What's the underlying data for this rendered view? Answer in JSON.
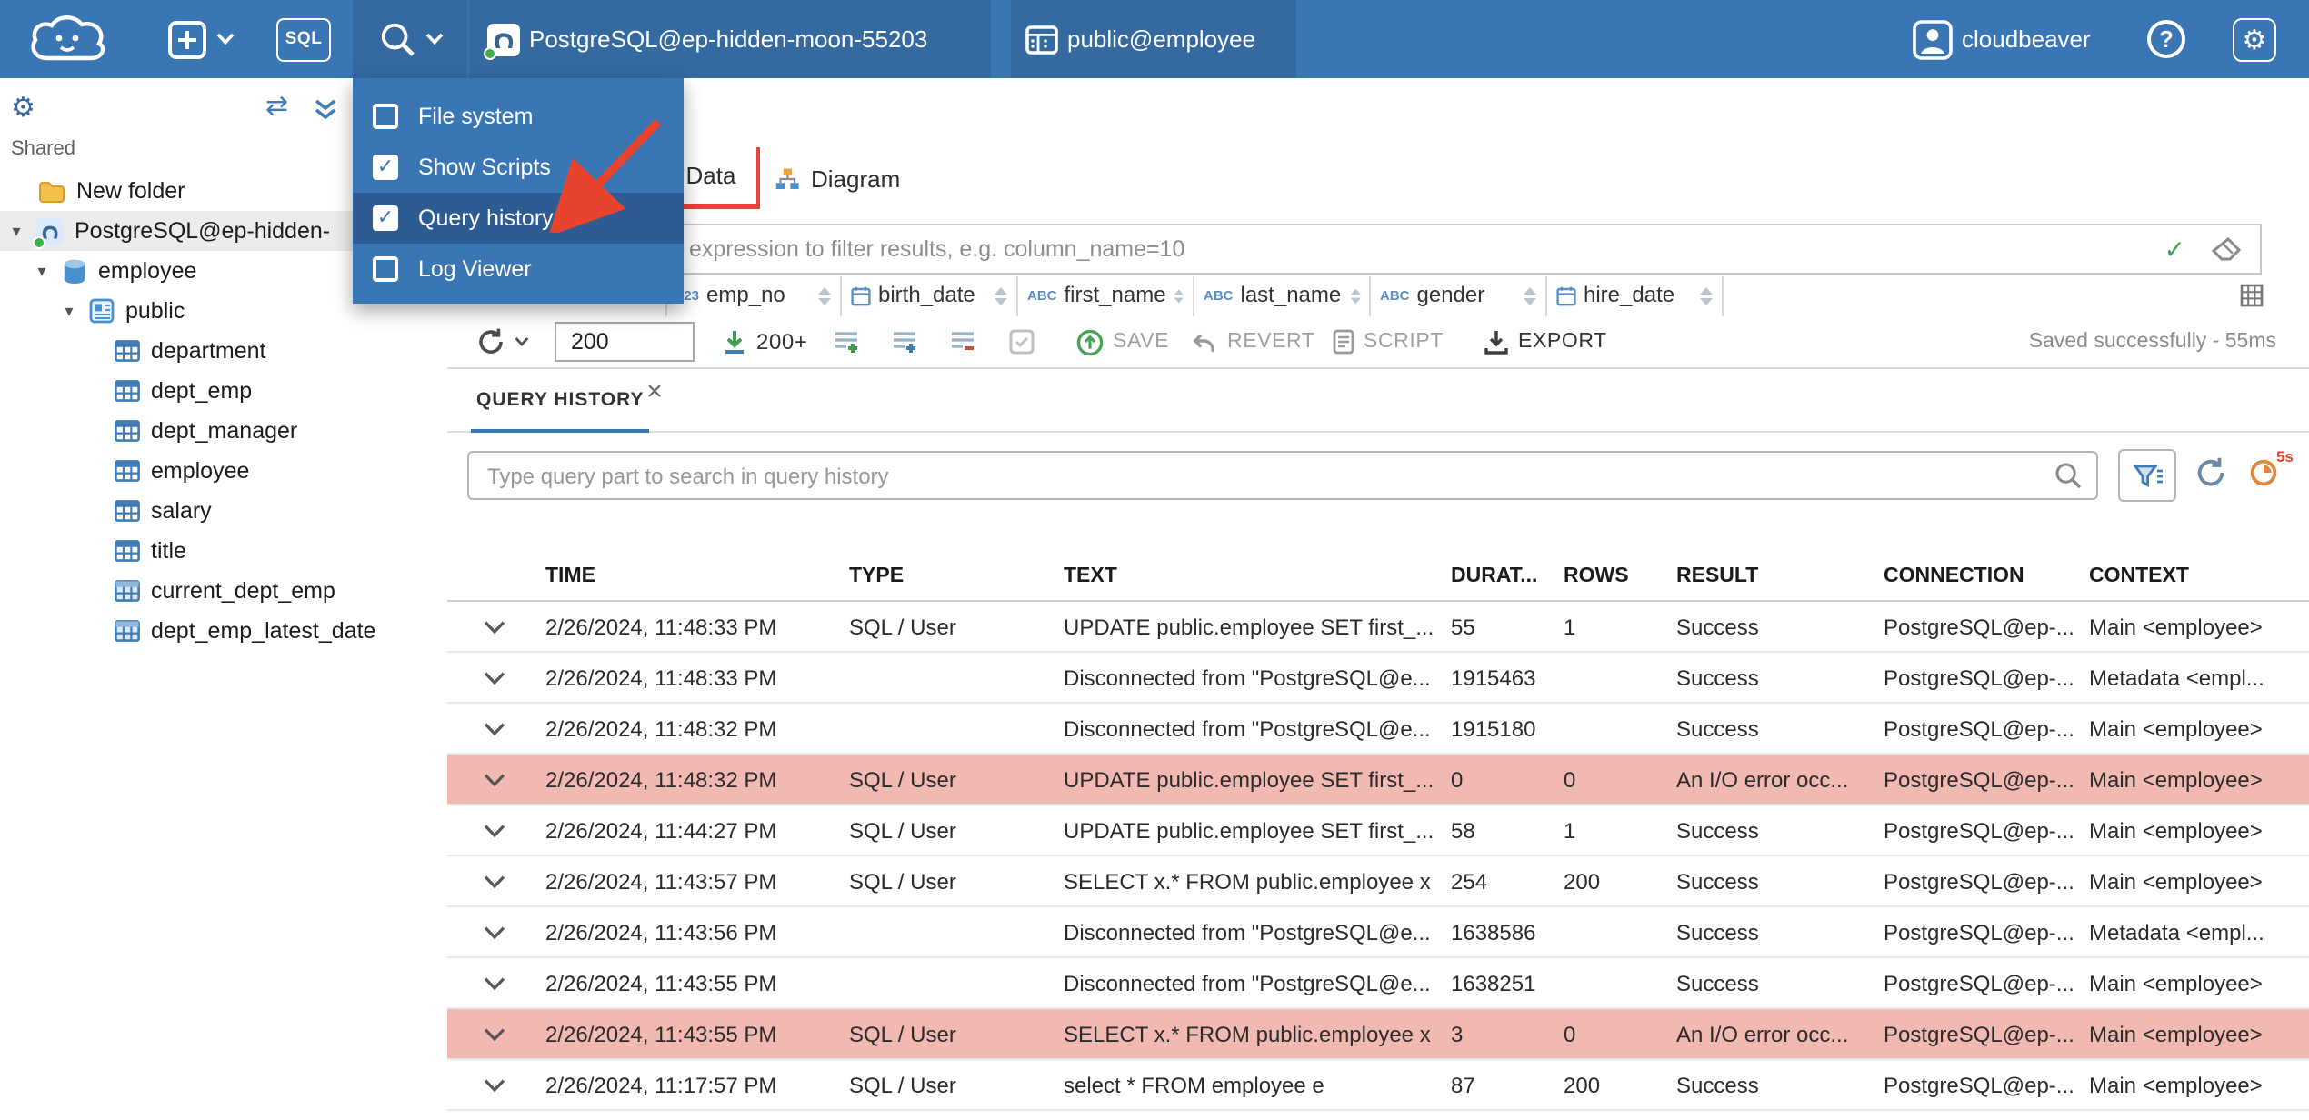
{
  "colors": {
    "topbar": "#3b76b4",
    "menu_highlight": "#2c5c92",
    "accent_red": "#e8433c",
    "error_row": "#f2b9b3",
    "active_tab_underline": "#3a76b6",
    "success_green": "#3fa349"
  },
  "icons": {
    "check": "✓",
    "close": "×",
    "help": "?",
    "gear": "⚙",
    "swap": "⇄",
    "tree_expanded": "▾"
  },
  "topbar": {
    "sql_button": "SQL",
    "connection": "PostgreSQL@ep-hidden-moon-55203",
    "schema": "public@employee",
    "user": "cloudbeaver"
  },
  "view_menu": {
    "items": [
      {
        "label": "File system",
        "checked": false
      },
      {
        "label": "Show Scripts",
        "checked": true
      },
      {
        "label": "Query history",
        "checked": true
      },
      {
        "label": "Log Viewer",
        "checked": false
      }
    ]
  },
  "sidebar": {
    "section": "Shared",
    "tree": [
      {
        "label": "New folder"
      },
      {
        "label": "PostgreSQL@ep-hidden-"
      },
      {
        "label": "employee"
      },
      {
        "label": "public"
      },
      {
        "label": "department"
      },
      {
        "label": "dept_emp"
      },
      {
        "label": "dept_manager"
      },
      {
        "label": "employee"
      },
      {
        "label": "salary"
      },
      {
        "label": "title"
      },
      {
        "label": "current_dept_emp"
      },
      {
        "label": "dept_emp_latest_date"
      }
    ]
  },
  "editor": {
    "tabs": [
      {
        "label": "Data"
      },
      {
        "label": "Diagram"
      }
    ],
    "filter_placeholder": "expression to filter results, e.g. column_name=10",
    "grid_columns": [
      {
        "name": "emp_no",
        "type": "number",
        "type_icon": "123"
      },
      {
        "name": "birth_date",
        "type": "date",
        "type_icon": ""
      },
      {
        "name": "first_name",
        "type": "string",
        "type_icon": "ABC"
      },
      {
        "name": "last_name",
        "type": "string",
        "type_icon": "ABC"
      },
      {
        "name": "gender",
        "type": "string",
        "type_icon": "ABC"
      },
      {
        "name": "hire_date",
        "type": "date",
        "type_icon": ""
      }
    ],
    "toolbar": {
      "fetch_size": "200",
      "fetch_more": "200+",
      "save": "SAVE",
      "revert": "REVERT",
      "script": "SCRIPT",
      "export": "EXPORT",
      "status": "Saved successfully - 55ms"
    }
  },
  "query_history": {
    "tab": "QUERY HISTORY",
    "search_placeholder": "Type query part to search in query history",
    "auto_refresh_badge": "5s",
    "columns": [
      "TIME",
      "TYPE",
      "TEXT",
      "DURAT...",
      "ROWS",
      "RESULT",
      "CONNECTION",
      "CONTEXT"
    ],
    "rows": [
      {
        "time": "2/26/2024, 11:48:33 PM",
        "type": "SQL / User",
        "text": "UPDATE public.employee SET first_...",
        "duration": "55",
        "rows": "1",
        "result": "Success",
        "connection": "PostgreSQL@ep-...",
        "context": "Main <employee>",
        "error": false
      },
      {
        "time": "2/26/2024, 11:48:33 PM",
        "type": "",
        "text": "Disconnected from \"PostgreSQL@e...",
        "duration": "1915463",
        "rows": "",
        "result": "Success",
        "connection": "PostgreSQL@ep-...",
        "context": "Metadata <empl...",
        "error": false
      },
      {
        "time": "2/26/2024, 11:48:32 PM",
        "type": "",
        "text": "Disconnected from \"PostgreSQL@e...",
        "duration": "1915180",
        "rows": "",
        "result": "Success",
        "connection": "PostgreSQL@ep-...",
        "context": "Main <employee>",
        "error": false
      },
      {
        "time": "2/26/2024, 11:48:32 PM",
        "type": "SQL / User",
        "text": "UPDATE public.employee SET first_...",
        "duration": "0",
        "rows": "0",
        "result": "An I/O error occ...",
        "connection": "PostgreSQL@ep-...",
        "context": "Main <employee>",
        "error": true
      },
      {
        "time": "2/26/2024, 11:44:27 PM",
        "type": "SQL / User",
        "text": "UPDATE public.employee SET first_...",
        "duration": "58",
        "rows": "1",
        "result": "Success",
        "connection": "PostgreSQL@ep-...",
        "context": "Main <employee>",
        "error": false
      },
      {
        "time": "2/26/2024, 11:43:57 PM",
        "type": "SQL / User",
        "text": "SELECT x.* FROM public.employee x",
        "duration": "254",
        "rows": "200",
        "result": "Success",
        "connection": "PostgreSQL@ep-...",
        "context": "Main <employee>",
        "error": false
      },
      {
        "time": "2/26/2024, 11:43:56 PM",
        "type": "",
        "text": "Disconnected from \"PostgreSQL@e...",
        "duration": "1638586",
        "rows": "",
        "result": "Success",
        "connection": "PostgreSQL@ep-...",
        "context": "Metadata <empl...",
        "error": false
      },
      {
        "time": "2/26/2024, 11:43:55 PM",
        "type": "",
        "text": "Disconnected from \"PostgreSQL@e...",
        "duration": "1638251",
        "rows": "",
        "result": "Success",
        "connection": "PostgreSQL@ep-...",
        "context": "Main <employee>",
        "error": false
      },
      {
        "time": "2/26/2024, 11:43:55 PM",
        "type": "SQL / User",
        "text": "SELECT x.* FROM public.employee x",
        "duration": "3",
        "rows": "0",
        "result": "An I/O error occ...",
        "connection": "PostgreSQL@ep-...",
        "context": "Main <employee>",
        "error": true
      },
      {
        "time": "2/26/2024, 11:17:57 PM",
        "type": "SQL / User",
        "text": "select * FROM employee e",
        "duration": "87",
        "rows": "200",
        "result": "Success",
        "connection": "PostgreSQL@ep-...",
        "context": "Main <employee>",
        "error": false
      }
    ]
  }
}
